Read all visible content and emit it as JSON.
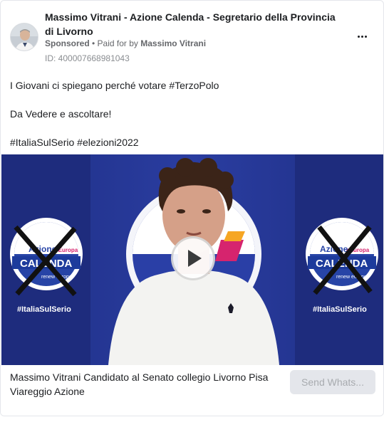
{
  "ad": {
    "page_name": "Massimo Vitrani - Azione Calenda - Segretario della Provincia di Livorno",
    "sponsored_label": "Sponsored",
    "separator": " • ",
    "paid_for_prefix": "Paid for by ",
    "paid_for_name": "Massimo Vitrani",
    "id_label": "ID: 400007668981043"
  },
  "post": {
    "line1": "I Giovani ci spiegano perché votare #TerzoPolo",
    "line2": "Da Vedere e ascoltare!",
    "line3": "#ItaliaSulSerio #elezioni2022"
  },
  "video": {
    "overlay_text_left": "#ItaliaSulSerio",
    "overlay_text_right": "#ItaliaSulSerio",
    "logo_text_top": "Azione",
    "logo_text_top2": "+Europa",
    "logo_text_main": "CALENDA",
    "logo_text_sub": "renew europe."
  },
  "footer": {
    "link_title": "Massimo Vitrani Candidato al Senato collegio Livorno Pisa Viareggio Azione",
    "cta_label": "Send Whats..."
  },
  "colors": {
    "video_bg": "#1c2f8a",
    "cta_bg": "#e4e6eb",
    "meta_text": "#65676b"
  },
  "icons": {
    "more": "more-horizontal-icon",
    "play": "play-icon"
  }
}
